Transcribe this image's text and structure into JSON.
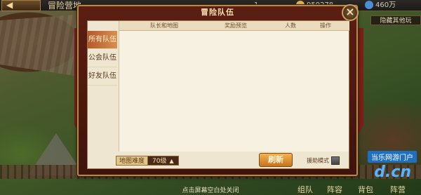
{
  "hud": {
    "back_label": "◀",
    "title": "冒险营地",
    "resource_a": "1",
    "resource_b": "959278",
    "resource_c": "460万",
    "side_right_label": "隐藏其他玩"
  },
  "dialog": {
    "title": "冒险队伍",
    "close_glyph": "×",
    "tabs": [
      {
        "label": "所有队伍",
        "active": true
      },
      {
        "label": "公会队伍",
        "active": false
      },
      {
        "label": "好友队伍",
        "active": false
      }
    ],
    "columns": [
      "队长和地图",
      "奖励预览",
      "人数",
      "操作"
    ],
    "filter_label": "地图难度",
    "filter_value": "70级",
    "filter_caret": "▲",
    "refresh_label": "刷新",
    "assist_label": "援助模式"
  },
  "footer": {
    "hint": "点击屏幕空白处关闭",
    "nav": [
      "组队",
      "阵容",
      "背包",
      "阵营"
    ]
  },
  "watermark": {
    "line1": "当乐网游门户",
    "line2": "d.cn"
  },
  "colors": {
    "dialog_bg": "#5c1e12",
    "panel_bg": "#efe6d1",
    "active_tab": "#b25a2b",
    "button": "#f3b34d"
  }
}
